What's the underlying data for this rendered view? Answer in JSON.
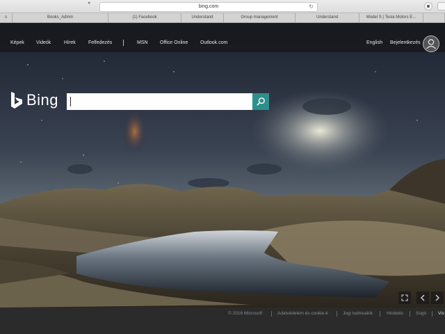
{
  "browser": {
    "url": "bing.com",
    "tabs": [
      {
        "label": "s"
      },
      {
        "label": "Books_Admin"
      },
      {
        "label": "(1) Facebook"
      },
      {
        "label": "Understand"
      },
      {
        "label": "Group management"
      },
      {
        "label": "Understand"
      },
      {
        "label": "Model S | Tesla Motors E..."
      },
      {
        "label": ""
      }
    ]
  },
  "nav": {
    "items": [
      {
        "label": "Képek"
      },
      {
        "label": "Videók"
      },
      {
        "label": "Hírek"
      },
      {
        "label": "Felfedezés"
      },
      {
        "label": "MSN"
      },
      {
        "label": "Office Online"
      },
      {
        "label": "Outlook.com"
      }
    ],
    "language": "English",
    "sign_in": "Bejelentkezés"
  },
  "logo": {
    "text": "Bing"
  },
  "search": {
    "value": "",
    "placeholder": ""
  },
  "controls": {
    "icons": [
      "expand-icon",
      "chevron-left-icon",
      "chevron-right-icon"
    ]
  },
  "footer": {
    "items": [
      {
        "label": "© 2016 Microsoft"
      },
      {
        "label": "Adatvédelem és cookie-k"
      },
      {
        "label": "Jogi tudnivalók"
      },
      {
        "label": "Hirdetés"
      },
      {
        "label": "Súgó"
      },
      {
        "label": "Vis"
      }
    ]
  },
  "colors": {
    "search_button": "#2f8f8b",
    "nav_background": "#181a1e",
    "footer_background": "#2b2b2b"
  }
}
